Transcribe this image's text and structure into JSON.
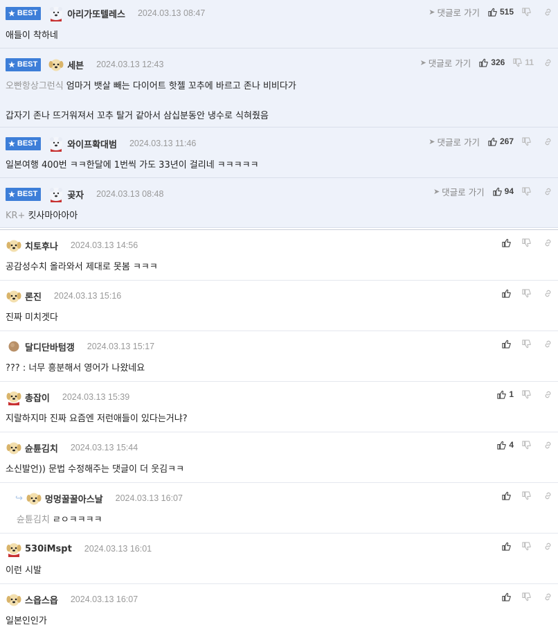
{
  "best_badge": "BEST",
  "reply_link": "댓글로 가기",
  "best": [
    {
      "nick": "아리가또텔레스",
      "date": "2024.03.13 08:47",
      "mention": "",
      "text": "애들이 착하네",
      "text2": "",
      "up": "515",
      "down": ""
    },
    {
      "nick": "세븐",
      "date": "2024.03.13 12:43",
      "mention": "오빤항상그런식",
      "text": "엄마거 뱃살 빼는 다이어트 핫젤 꼬추에 바르고 존나 비비다가",
      "text2": "갑자기 존나 뜨거워져서 꼬추 탈거 같아서 삼십분동안 냉수로 식혀줬음",
      "up": "326",
      "down": "11"
    },
    {
      "nick": "와이프확대범",
      "date": "2024.03.13 11:46",
      "mention": "",
      "text": "일본여행 400번 ㅋㅋ한달에 1번씩 가도 33년이 걸리네 ㅋㅋㅋㅋㅋ",
      "text2": "",
      "up": "267",
      "down": ""
    },
    {
      "nick": "곶자",
      "date": "2024.03.13 08:48",
      "mention": "KR+",
      "text": "킷사마아아아",
      "text2": "",
      "up": "94",
      "down": ""
    }
  ],
  "comments": [
    {
      "nick": "치토후나",
      "date": "2024.03.13 14:56",
      "mention": "",
      "text": "공감성수치 올라와서 제대로 못봄 ㅋㅋㅋ",
      "up": "",
      "down": ""
    },
    {
      "nick": "론진",
      "date": "2024.03.13 15:16",
      "mention": "",
      "text": "진짜 미치겟다",
      "up": "",
      "down": ""
    },
    {
      "nick": "달디단바텀갱",
      "date": "2024.03.13 15:17",
      "mention": "",
      "text": "??? : 너무 흥분해서 영어가 나왔네요",
      "up": "",
      "down": ""
    },
    {
      "nick": "총잡이",
      "date": "2024.03.13 15:39",
      "mention": "",
      "text": "지랄하지마 진짜 요즘엔 저런애들이 있다는거냐?",
      "up": "1",
      "down": ""
    },
    {
      "nick": "슌튠김치",
      "date": "2024.03.13 15:44",
      "mention": "",
      "text": "소신발언)) 문법 수정해주는 댓글이 더 웃김ㅋㅋ",
      "up": "4",
      "down": ""
    },
    {
      "nick": "멍멍꿀꿀아스날",
      "date": "2024.03.13 16:07",
      "mention": "슌튠김치",
      "text": "ㄹㅇㅋㅋㅋㅋ",
      "up": "",
      "down": ""
    },
    {
      "nick": "530iMspt",
      "date": "2024.03.13 16:01",
      "mention": "",
      "text": "이런 시발",
      "up": "",
      "down": ""
    },
    {
      "nick": "스읍스읍",
      "date": "2024.03.13 16:07",
      "mention": "",
      "text": "일본인인가",
      "up": "",
      "down": ""
    }
  ]
}
